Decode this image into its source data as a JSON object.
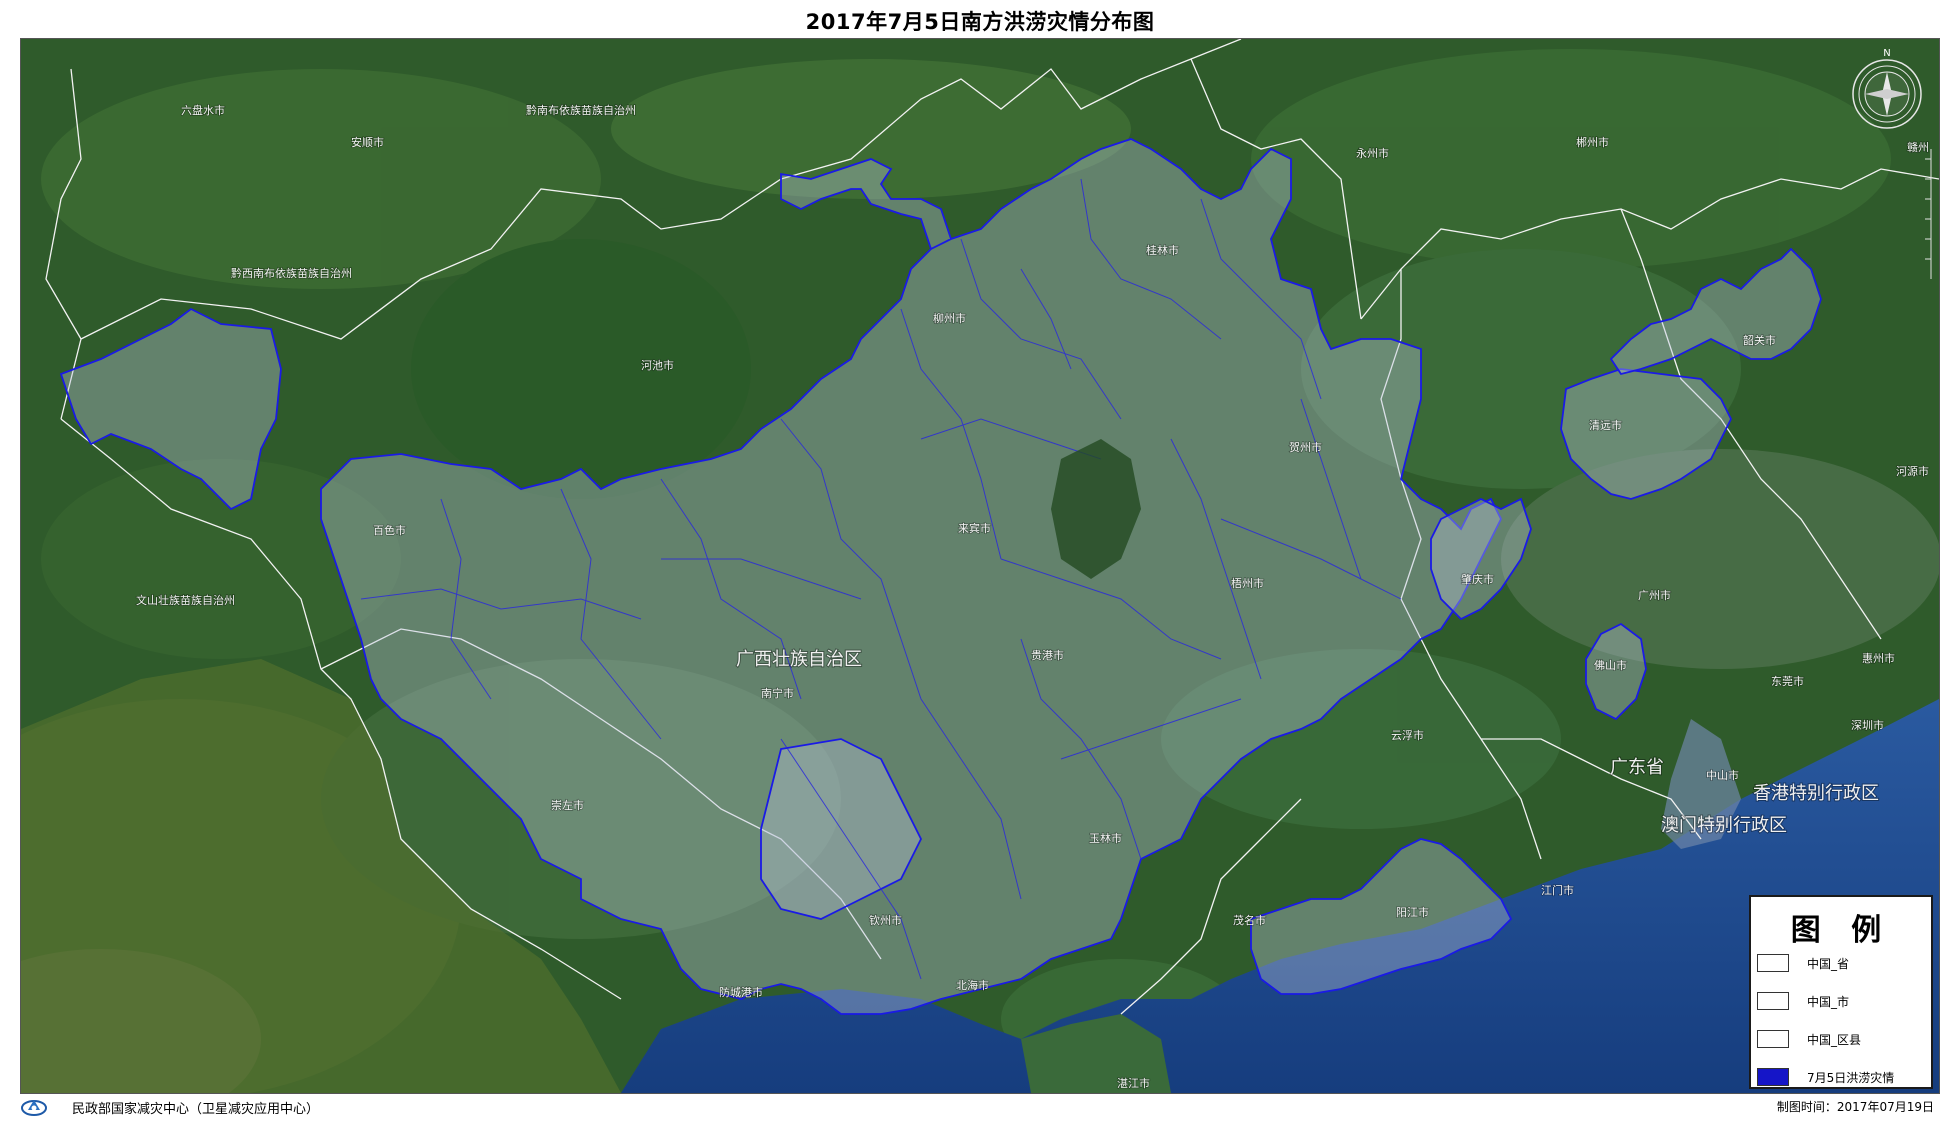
{
  "title": "2017年7月5日南方洪涝灾情分布图",
  "map": {
    "places": [
      {
        "name": "六盘水市",
        "big": false
      },
      {
        "name": "安顺市",
        "big": false
      },
      {
        "name": "黔南布依族苗族自治州",
        "big": false
      },
      {
        "name": "黔西南布依族苗族自治州",
        "big": false
      },
      {
        "name": "河池市",
        "big": false
      },
      {
        "name": "百色市",
        "big": false
      },
      {
        "name": "文山壮族苗族自治州",
        "big": false
      },
      {
        "name": "柳州市",
        "big": false
      },
      {
        "name": "桂林市",
        "big": false
      },
      {
        "name": "永州市",
        "big": false
      },
      {
        "name": "郴州市",
        "big": false
      },
      {
        "name": "韶关市",
        "big": false
      },
      {
        "name": "清远市",
        "big": false
      },
      {
        "name": "河源市",
        "big": false
      },
      {
        "name": "贺州市",
        "big": false
      },
      {
        "name": "来宾市",
        "big": false
      },
      {
        "name": "梧州市",
        "big": false
      },
      {
        "name": "肇庆市",
        "big": false
      },
      {
        "name": "广州市",
        "big": false
      },
      {
        "name": "惠州市",
        "big": false
      },
      {
        "name": "佛山市",
        "big": false
      },
      {
        "name": "东莞市",
        "big": false
      },
      {
        "name": "深圳市",
        "big": false
      },
      {
        "name": "中山市",
        "big": false
      },
      {
        "name": "江门市",
        "big": false
      },
      {
        "name": "广西壮族自治区",
        "big": true
      },
      {
        "name": "南宁市",
        "big": false
      },
      {
        "name": "贵港市",
        "big": false
      },
      {
        "name": "云浮市",
        "big": false
      },
      {
        "name": "崇左市",
        "big": false
      },
      {
        "name": "玉林市",
        "big": false
      },
      {
        "name": "钦州市",
        "big": false
      },
      {
        "name": "防城港市",
        "big": false
      },
      {
        "name": "北海市",
        "big": false
      },
      {
        "name": "茂名市",
        "big": false
      },
      {
        "name": "阳江市",
        "big": false
      },
      {
        "name": "湛江市",
        "big": false
      },
      {
        "name": "广东省",
        "big": true
      },
      {
        "name": "香港特别行政区",
        "big": true
      },
      {
        "name": "澳门特别行政区",
        "big": true
      },
      {
        "name": "赣州",
        "big": false
      }
    ],
    "compass_label": "N"
  },
  "legend": {
    "title": "图 例",
    "items": [
      {
        "label": "中国_省",
        "color": "#ffffff",
        "border": "#333333"
      },
      {
        "label": "中国_市",
        "color": "#ffffff",
        "border": "#333333"
      },
      {
        "label": "中国_区县",
        "color": "#ffffff",
        "border": "#333333"
      },
      {
        "label": "7月5日洪涝灾情",
        "color": "#1515c8",
        "border": "#333333"
      }
    ]
  },
  "footer": {
    "organization": "民政部国家减灾中心（卫星减灾应用中心）",
    "made_time": "制图时间：2017年07月19日"
  },
  "colors": {
    "forest": "#2d5a2a",
    "sea": "#1f4d8f",
    "flood_fill": "rgba(185,195,215,0.38)",
    "flood_border": "#1a1ae6",
    "boundary": "#f2f2f2"
  }
}
